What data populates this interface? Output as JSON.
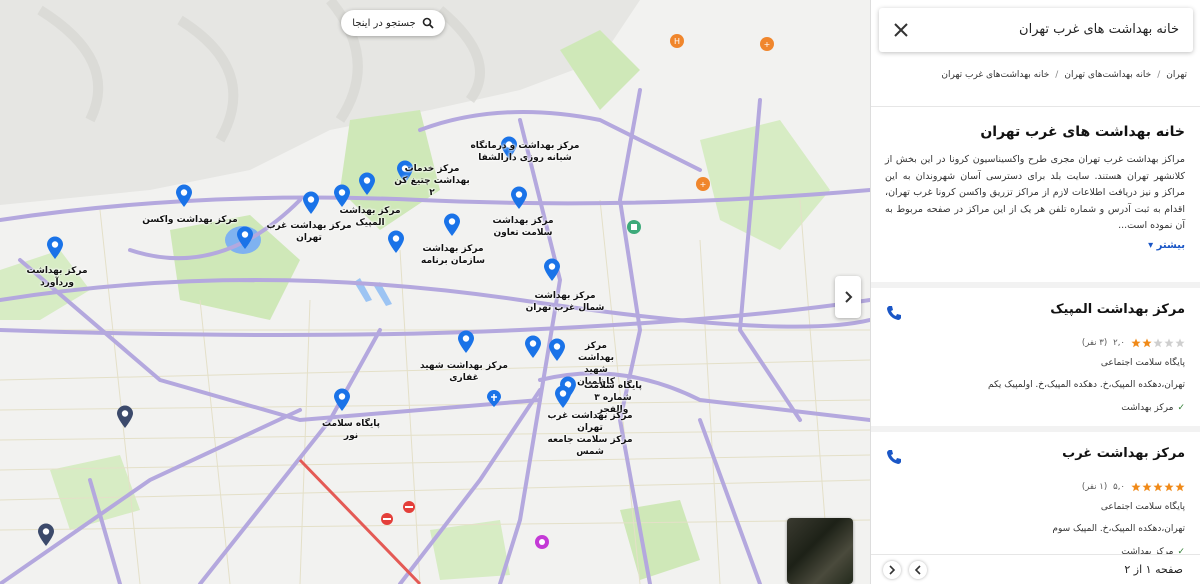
{
  "search": {
    "query": "خانه بهداشت های غرب تهران",
    "search_here_label": "جستجو در اینجا"
  },
  "breadcrumb": [
    "تهران",
    "خانه بهداشت‌های تهران",
    "خانه بهداشت‌های غرب تهران"
  ],
  "panel": {
    "title": "خانه بهداشت های غرب تهران",
    "description": "مراکز بهداشت غرب تهران مجری طرح واکسیناسیون کرونا در این بخش از کلانشهر تهران هستند. سایت بلد برای دسترسی آسان شهروندان به این مراکز و نیز دریافت اطلاعات لازم از مراکز تزریق واکسن کرونا غرب تهران، اقدام به ثبت آدرس و شماره تلفن هر یک از این مراکز در صفحه مربوط به آن نموده است...",
    "more_label": "بیشتر"
  },
  "results": [
    {
      "name": "مرکز بهداشت المپیک",
      "stars": 2,
      "rating": "۲,۰",
      "reviews": "(۳ نفر)",
      "type": "پایگاه سلامت اجتماعی",
      "address": "تهران،دهکده المپیک،خ. دهکده المپیک،خ. اولمپیک یکم",
      "feature": "مرکز بهداشت"
    },
    {
      "name": "مرکز بهداشت غرب",
      "stars": 5,
      "rating": "۵,۰",
      "reviews": "(۱ نفر)",
      "type": "پایگاه سلامت اجتماعی",
      "address": "تهران،دهکده المپیک،خ. المپیک سوم",
      "feature": "مرکز بهداشت"
    }
  ],
  "pagination": {
    "label": "صفحه ۱ از ۲"
  },
  "map_labels": [
    "مرکز بهداشت و درمانگاه\nشبانه روزی دارالشفا",
    "مرکز خدمات\nبهداشت چتیغ کن ۲",
    "مرکز بهداشت المپیک",
    "مرکز بهداشت غرب تهران",
    "مرکز بهداشت واکسن",
    "مرکز بهداشت\nسلامت تعاون",
    "مرکز بهداشت\nسازمان برنامه",
    "مرکز بهداشت وردآورد",
    "مرکز بهداشت\nشمال غرب تهران",
    "مرکز بهداشت\nشهید کاظمیان",
    "مرکز بهداشت شهید غفاری",
    "پایگاه سلامت\nشماره ۳ والفجر",
    "پایگاه سلامت نور",
    "مرکز بهداشت غرب تهران\nمرکز سلامت جامعه شمس"
  ],
  "place_labels": [
    "بیمارستان",
    "کلینیک",
    "پارک",
    "مرکز خرید"
  ],
  "colors": {
    "pin": "#1a73e8",
    "pin_dark": "#3c4a6b",
    "road": "#b4a8de",
    "green": "#c9e6b2",
    "star": "#f08a19",
    "accent": "#1a56c6"
  }
}
